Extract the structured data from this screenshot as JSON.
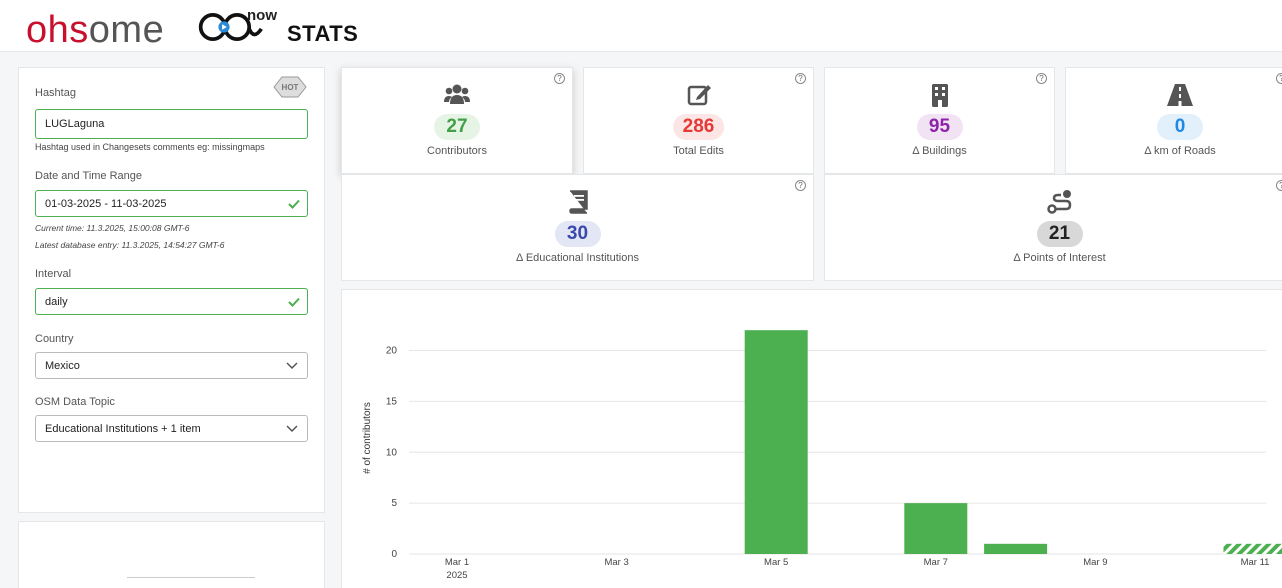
{
  "header": {
    "logo_a": "oh",
    "logo_b": "s",
    "logo_c": "ome",
    "logo_now": "now",
    "logo_stats": "STATS"
  },
  "filters": {
    "hot_badge": "HOT",
    "hashtag_label": "Hashtag",
    "hashtag_value": "LUGLaguna",
    "hashtag_hint": "Hashtag used in Changesets comments eg: missingmaps",
    "date_label": "Date and Time Range",
    "date_value": "01-03-2025 - 11-03-2025",
    "current_time": "Current time: 11.3.2025, 15:00:08 GMT-6",
    "latest_entry": "Latest database entry: 11.3.2025, 14:54:27 GMT-6",
    "interval_label": "Interval",
    "interval_value": "daily",
    "country_label": "Country",
    "country_value": "Mexico",
    "topic_label": "OSM Data Topic",
    "topic_value": "Educational Institutions + 1 item"
  },
  "stats": [
    {
      "label": "Contributors",
      "value": "27",
      "color": "#43a047",
      "bg": "#e6f4e6",
      "icon": "users-icon"
    },
    {
      "label": "Total Edits",
      "value": "286",
      "color": "#e53935",
      "bg": "#fbe5e5",
      "icon": "edit-icon"
    },
    {
      "label": "Δ Buildings",
      "value": "95",
      "color": "#8e24aa",
      "bg": "#f1e3f4",
      "icon": "building-icon"
    },
    {
      "label": "Δ km of Roads",
      "value": "0",
      "color": "#1e88e5",
      "bg": "#e2f0fb",
      "icon": "road-icon"
    },
    {
      "label": "Δ Educational Institutions",
      "value": "30",
      "color": "#3949ab",
      "bg": "#e3e6f4",
      "icon": "book-icon"
    },
    {
      "label": "Δ Points of Interest",
      "value": "21",
      "color": "#222222",
      "bg": "#d8d8d8",
      "icon": "route-icon"
    }
  ],
  "chart_data": {
    "type": "bar",
    "ylabel": "# of contributors",
    "xlabel": "",
    "ylim": [
      0,
      23
    ],
    "yticks": [
      0,
      5,
      10,
      15,
      20
    ],
    "x_tick_labels": [
      "Mar 1",
      "Mar 3",
      "Mar 5",
      "Mar 7",
      "Mar 9",
      "Mar 11"
    ],
    "x_year_label": "2025",
    "categories": [
      "Mar 1",
      "Mar 2",
      "Mar 3",
      "Mar 4",
      "Mar 5",
      "Mar 6",
      "Mar 7",
      "Mar 8",
      "Mar 9",
      "Mar 10",
      "Mar 11"
    ],
    "values": [
      0,
      0,
      0,
      0,
      22,
      0,
      5,
      1,
      0,
      0,
      1
    ],
    "partial_last": true,
    "bar_color": "#4caf50",
    "grid": true
  }
}
